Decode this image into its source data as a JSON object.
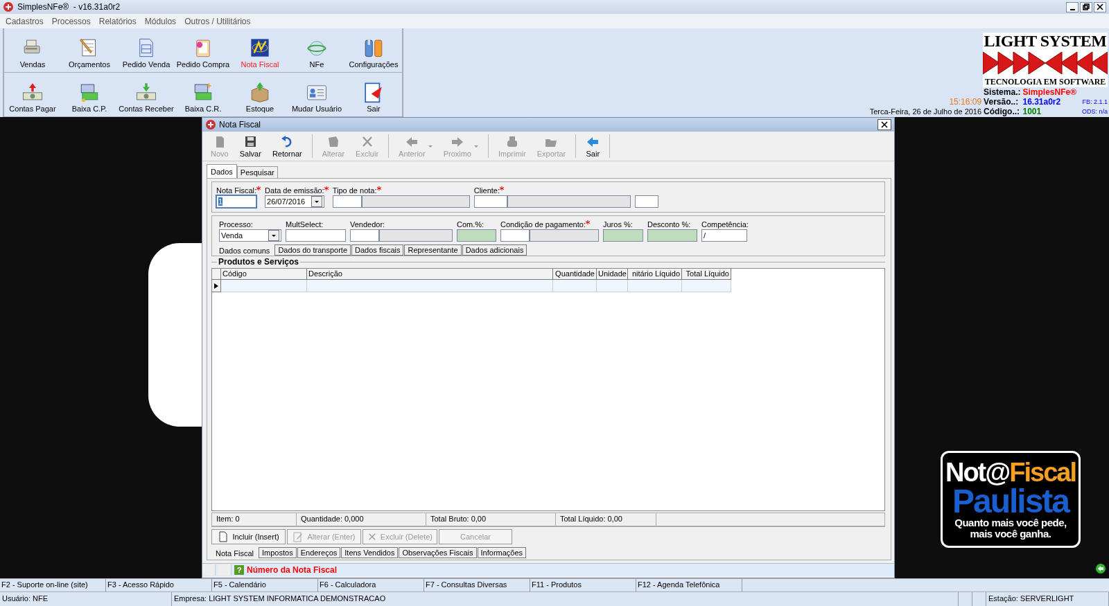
{
  "window": {
    "title": "SimplesNFe®  - v16.31a0r2"
  },
  "menu": [
    "Cadastros",
    "Processos",
    "Relatórios",
    "Módulos",
    "Outros / Utilitários"
  ],
  "toolbar_rows": [
    [
      {
        "label": "Vendas",
        "selected": false
      },
      {
        "label": "Orçamentos",
        "selected": false
      },
      {
        "label": "Pedido Venda",
        "selected": false
      },
      {
        "label": "Pedido Compra",
        "selected": false
      },
      {
        "label": "Nota Fiscal",
        "selected": true
      },
      {
        "label": "NFe",
        "selected": false
      },
      {
        "label": "Configurações",
        "selected": false
      }
    ],
    [
      {
        "label": "Contas Pagar",
        "selected": false
      },
      {
        "label": "Baixa C.P.",
        "selected": false
      },
      {
        "label": "Contas Receber",
        "selected": false
      },
      {
        "label": "Baixa C.R.",
        "selected": false
      },
      {
        "label": "Estoque",
        "selected": false
      },
      {
        "label": "Mudar Usuário",
        "selected": false
      },
      {
        "label": "Sair",
        "selected": false
      }
    ]
  ],
  "info": {
    "brand": "LIGHT SYSTEM",
    "tagline": "TECNOLOGIA EM SOFTWARE",
    "time": "15:16:09",
    "date": "Terca-Feira, 26 de Julho de 2016",
    "rows": [
      {
        "label": "Sistema.:",
        "value": "SimplesNFe®",
        "color": "#ff0000"
      },
      {
        "label": "Versão..:",
        "value": "16.31a0r2",
        "color": "#0000ff"
      },
      {
        "label": "Código..:",
        "value": "1001",
        "color": "#008000"
      }
    ],
    "side": [
      "FB: 2.1.1",
      "ODS: n/a"
    ]
  },
  "background_logo": {
    "part1": "Not@",
    "part2": "Fiscal",
    "line2": "Paulista",
    "slogan": [
      "Quanto mais você pede,",
      "mais você ganha."
    ]
  },
  "dialog": {
    "title": "Nota Fiscal",
    "toolbar": [
      {
        "label": "Novo",
        "disabled": true,
        "has_menu": false
      },
      {
        "label": "Salvar",
        "disabled": false,
        "has_menu": false
      },
      {
        "label": "Retornar",
        "disabled": false,
        "has_menu": false
      },
      {
        "label": "Alterar",
        "disabled": true,
        "has_menu": false
      },
      {
        "label": "Excluir",
        "disabled": true,
        "has_menu": false
      },
      {
        "label": "Anterior",
        "disabled": true,
        "has_menu": true
      },
      {
        "label": "Proximo",
        "disabled": true,
        "has_menu": true
      },
      {
        "label": "Imprimir",
        "disabled": true,
        "has_menu": false
      },
      {
        "label": "Exportar",
        "disabled": true,
        "has_menu": false
      },
      {
        "label": "Sair",
        "disabled": false,
        "has_menu": false
      }
    ],
    "tabs": [
      {
        "label": "Dados",
        "selected": true
      },
      {
        "label": "Pesquisar",
        "selected": false
      }
    ],
    "header_fields": [
      {
        "label": "Nota Fiscal:",
        "kind": "text",
        "value": "1",
        "required": true,
        "focused": true
      },
      {
        "label": "Data de emissão:",
        "kind": "date",
        "value": "26/07/2016",
        "required": true,
        "focused": false
      },
      {
        "label": "Tipo de nota:",
        "kind": "lookup",
        "required": true,
        "focused": false
      },
      {
        "label": "Cliente:",
        "kind": "lookup_wide",
        "required": true,
        "focused": false
      },
      {
        "kind": "box",
        "focused": false
      }
    ],
    "process_fields": [
      {
        "label": "Processo:",
        "kind": "combo",
        "value": "Venda",
        "required": false
      },
      {
        "label": "MultSelect:",
        "kind": "text",
        "required": false
      },
      {
        "label": "Vendedor:",
        "kind": "lookup",
        "required": false
      },
      {
        "label": "Com.%:",
        "kind": "readonly",
        "required": false
      },
      {
        "label": "Condição de pagamento:",
        "kind": "lookup",
        "required": true
      },
      {
        "label": "Juros %:",
        "kind": "readonly",
        "required": false
      },
      {
        "label": "Desconto %:",
        "kind": "readonly",
        "required": false
      },
      {
        "label": "Competência:",
        "kind": "text",
        "value": "/",
        "required": false
      }
    ],
    "subtabs": [
      {
        "label": "Dados comuns",
        "selected": true
      },
      {
        "label": "Dados do transporte",
        "selected": false
      },
      {
        "label": "Dados fiscais",
        "selected": false
      },
      {
        "label": "Representante",
        "selected": false
      },
      {
        "label": "Dados adicionais",
        "selected": false
      }
    ],
    "grid": {
      "title": "Produtos e Serviços",
      "columns": [
        "Código",
        "Descrição",
        "Quantidade",
        "Unidade",
        "nitário Líquido",
        "Total Líquido"
      ],
      "rows": [
        {
          "current": true
        }
      ]
    },
    "summary": [
      "Item: 0",
      "Quantidade: 0,000",
      "Total Bruto: 0,00",
      "Total Líquido: 0,00"
    ],
    "actions": [
      {
        "label": "Incluir (Insert)",
        "disabled": false
      },
      {
        "label": "Alterar (Enter)",
        "disabled": true
      },
      {
        "label": "Excluir (Delete)",
        "disabled": true
      },
      {
        "label": "Cancelar",
        "disabled": true
      }
    ],
    "bottom_tabs": [
      {
        "label": "Nota Fiscal",
        "selected": true
      },
      {
        "label": "Impostos",
        "selected": false
      },
      {
        "label": "Endereços",
        "selected": false
      },
      {
        "label": "Itens Vendidos",
        "selected": false
      },
      {
        "label": "Observações Fiscais",
        "selected": false
      },
      {
        "label": "Informações",
        "selected": false
      }
    ],
    "hint_icon": "?",
    "hint": "Número da Nota Fiscal"
  },
  "function_keys": [
    "F2 - Suporte on-line (site)",
    "F3 - Acesso Rápido",
    "F5 - Calendário",
    "F6 - Calculadora",
    "F7 - Consultas Diversas",
    "F11 - Produtos",
    "F12 - Agenda Telefônica"
  ],
  "status_bar": [
    "Usuário: NFE",
    "Empresa: LIGHT SYSTEM INFORMATICA DEMONSTRACAO",
    "Estação: SERVERLIGHT"
  ]
}
